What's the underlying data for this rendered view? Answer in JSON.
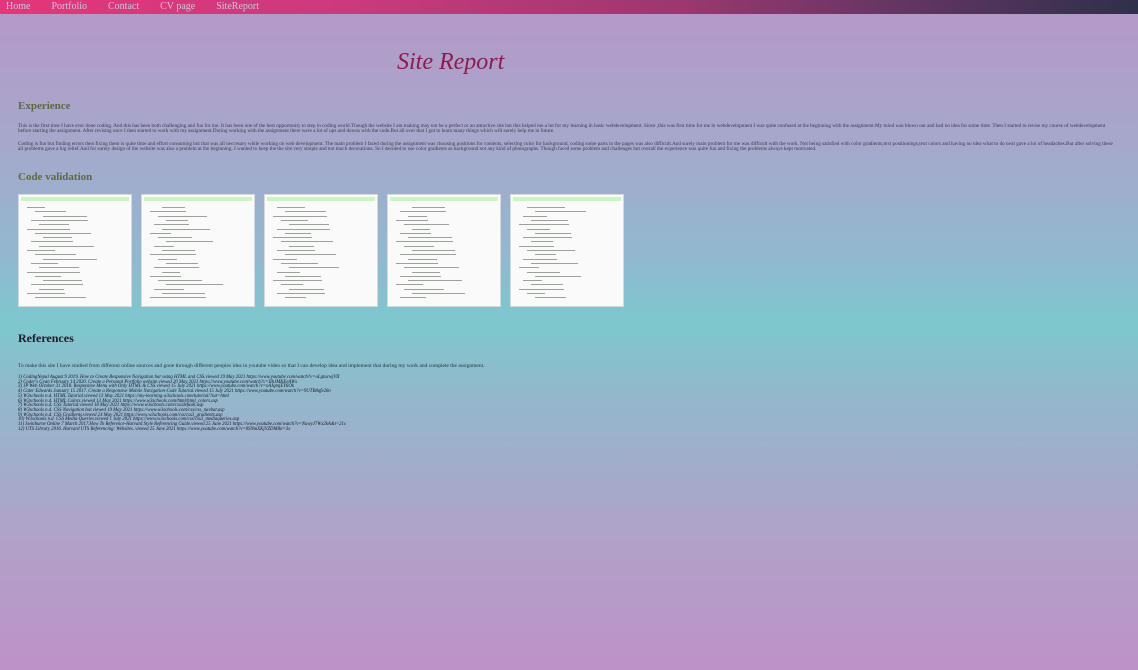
{
  "nav": [
    "Home",
    "Portfolio",
    "Contact",
    "CV page",
    "SiteReport"
  ],
  "title": "Site Report",
  "experience": {
    "heading": "Experience",
    "p1": "This is the first time I have ever done coding. And this has been both challenging and fun for me. It has been one of the best opportunity to step in coding world.Though the website I am making may not be a perfect or an attractive site but this helped me a lot for my learning in basic webdevelopment. Since ,this was first time for me in webdevelopment I was quite confused at the beginning with the assignment.My mind was blown out and had no idea for some time. Then I started to revise my course of webdevelopment before starting the assignment. After revising once I then started to work with my assignment.During working with the assignment there were a lot of ups and downs with the code.But all over that I got to learn many things which will surely help me in future.",
    "p2": "Coding is fun but finding errors then fixing them is quite time and effort consuming but that was all neccesary while working on web development. The main problem I faced during the assignment was choosing positions for contents, selecting color for background, coding some parts in the pages was also difficult.And surely main problem for me was difficult with the work. Not being satisfied with color gradients,text positionings,text colors and having no idea what to do next gave a lot of headaches.But after solving these all problems gave a big relief.And for surely design of the website was also a problem at the beginning. I wanted to keep the the site very simple and not much decorations. So I decided to use color gradients as background not any kind of photographs. Though faced some problem and challenges but overall the experience was quite fun and fixing the problems always kept motivated."
  },
  "code_validation": {
    "heading": "Code validation",
    "thumbnails": [
      "validation-screenshot-1",
      "validation-screenshot-2",
      "validation-screenshot-3",
      "validation-screenshot-4",
      "validation-screenshot-5"
    ]
  },
  "references": {
    "heading": "References",
    "intro": "To make this site I have studied from different online sources and gone through different peoples idea in youtube video so that I can develop idea and implement that during my work and complete the assignment.",
    "items": [
      "1) CodingNepal August 9 2019. How to Create Responsive Navigation bar using HTML and CSS.viewed 19 May 2021 https://www.youtube.com/watch?v=oLgtucwjVII",
      "2) Coder's Gyan February 14 2020. Create a Personal Portfolio website.viewed 20 May 2021 https://www.youtube.com/watch?v=IIhJMKEeAWs",
      "3) JP Web October 31 2018. Responsive Menu with Only HTML & CSS.viewed 15 July 2021 https://www.youtube.com/watch?v=xAJqmjEY6Ok",
      "4) Cater Edwards January 15 2017. Create a Responsive Mobile Navigation-Code Tutorial.viewed 15 July 2021 https://www.youtube.com/watch?v=9UTB8qfe28o",
      "5) W3schools n.d. HTML Tutorial.viewed 13 May 2021 https://my-learning.w3schools.com/tutorial/?tut=html",
      "6) W3schools n.d. HTML Colors.viewed 13 May 2021 https://www.w3schools.com/html/html_colors.asp",
      "7) W3schools n.d. CSS Tutorial.viewed 18 May 2021 https://www.w3schools.com/css/default.asp",
      "8) W3schools n.d. CSS Navigation bar.viewed 19 May 2021 https://www.w3schools.com/css/css_navbar.asp",
      "9) W3schools n.d. CSS Gradients.viewed 24 May 2021 https://www.w3schools.com/css/css3_gradients.asp",
      "10) W3schools n.d. CSS Media Queries.viewed 1 July 2021 https://www.w3schools.com/css/css3_mediaqueries.asp",
      "11) Swinburne Online 7 March 2017.How To Reference-Harvard Style Referencing Guide.viewed 25 June 2021 https://www.youtube.com/watch?v=NuwyJ7Wx2kA&t=21s",
      "12) UTS Library 2016. Harvard UTS Referencing: Websites. viewed 25 June 2021 https://www.youtube.com/watch?v=0SNmXKjYZDM&t=3s"
    ]
  }
}
